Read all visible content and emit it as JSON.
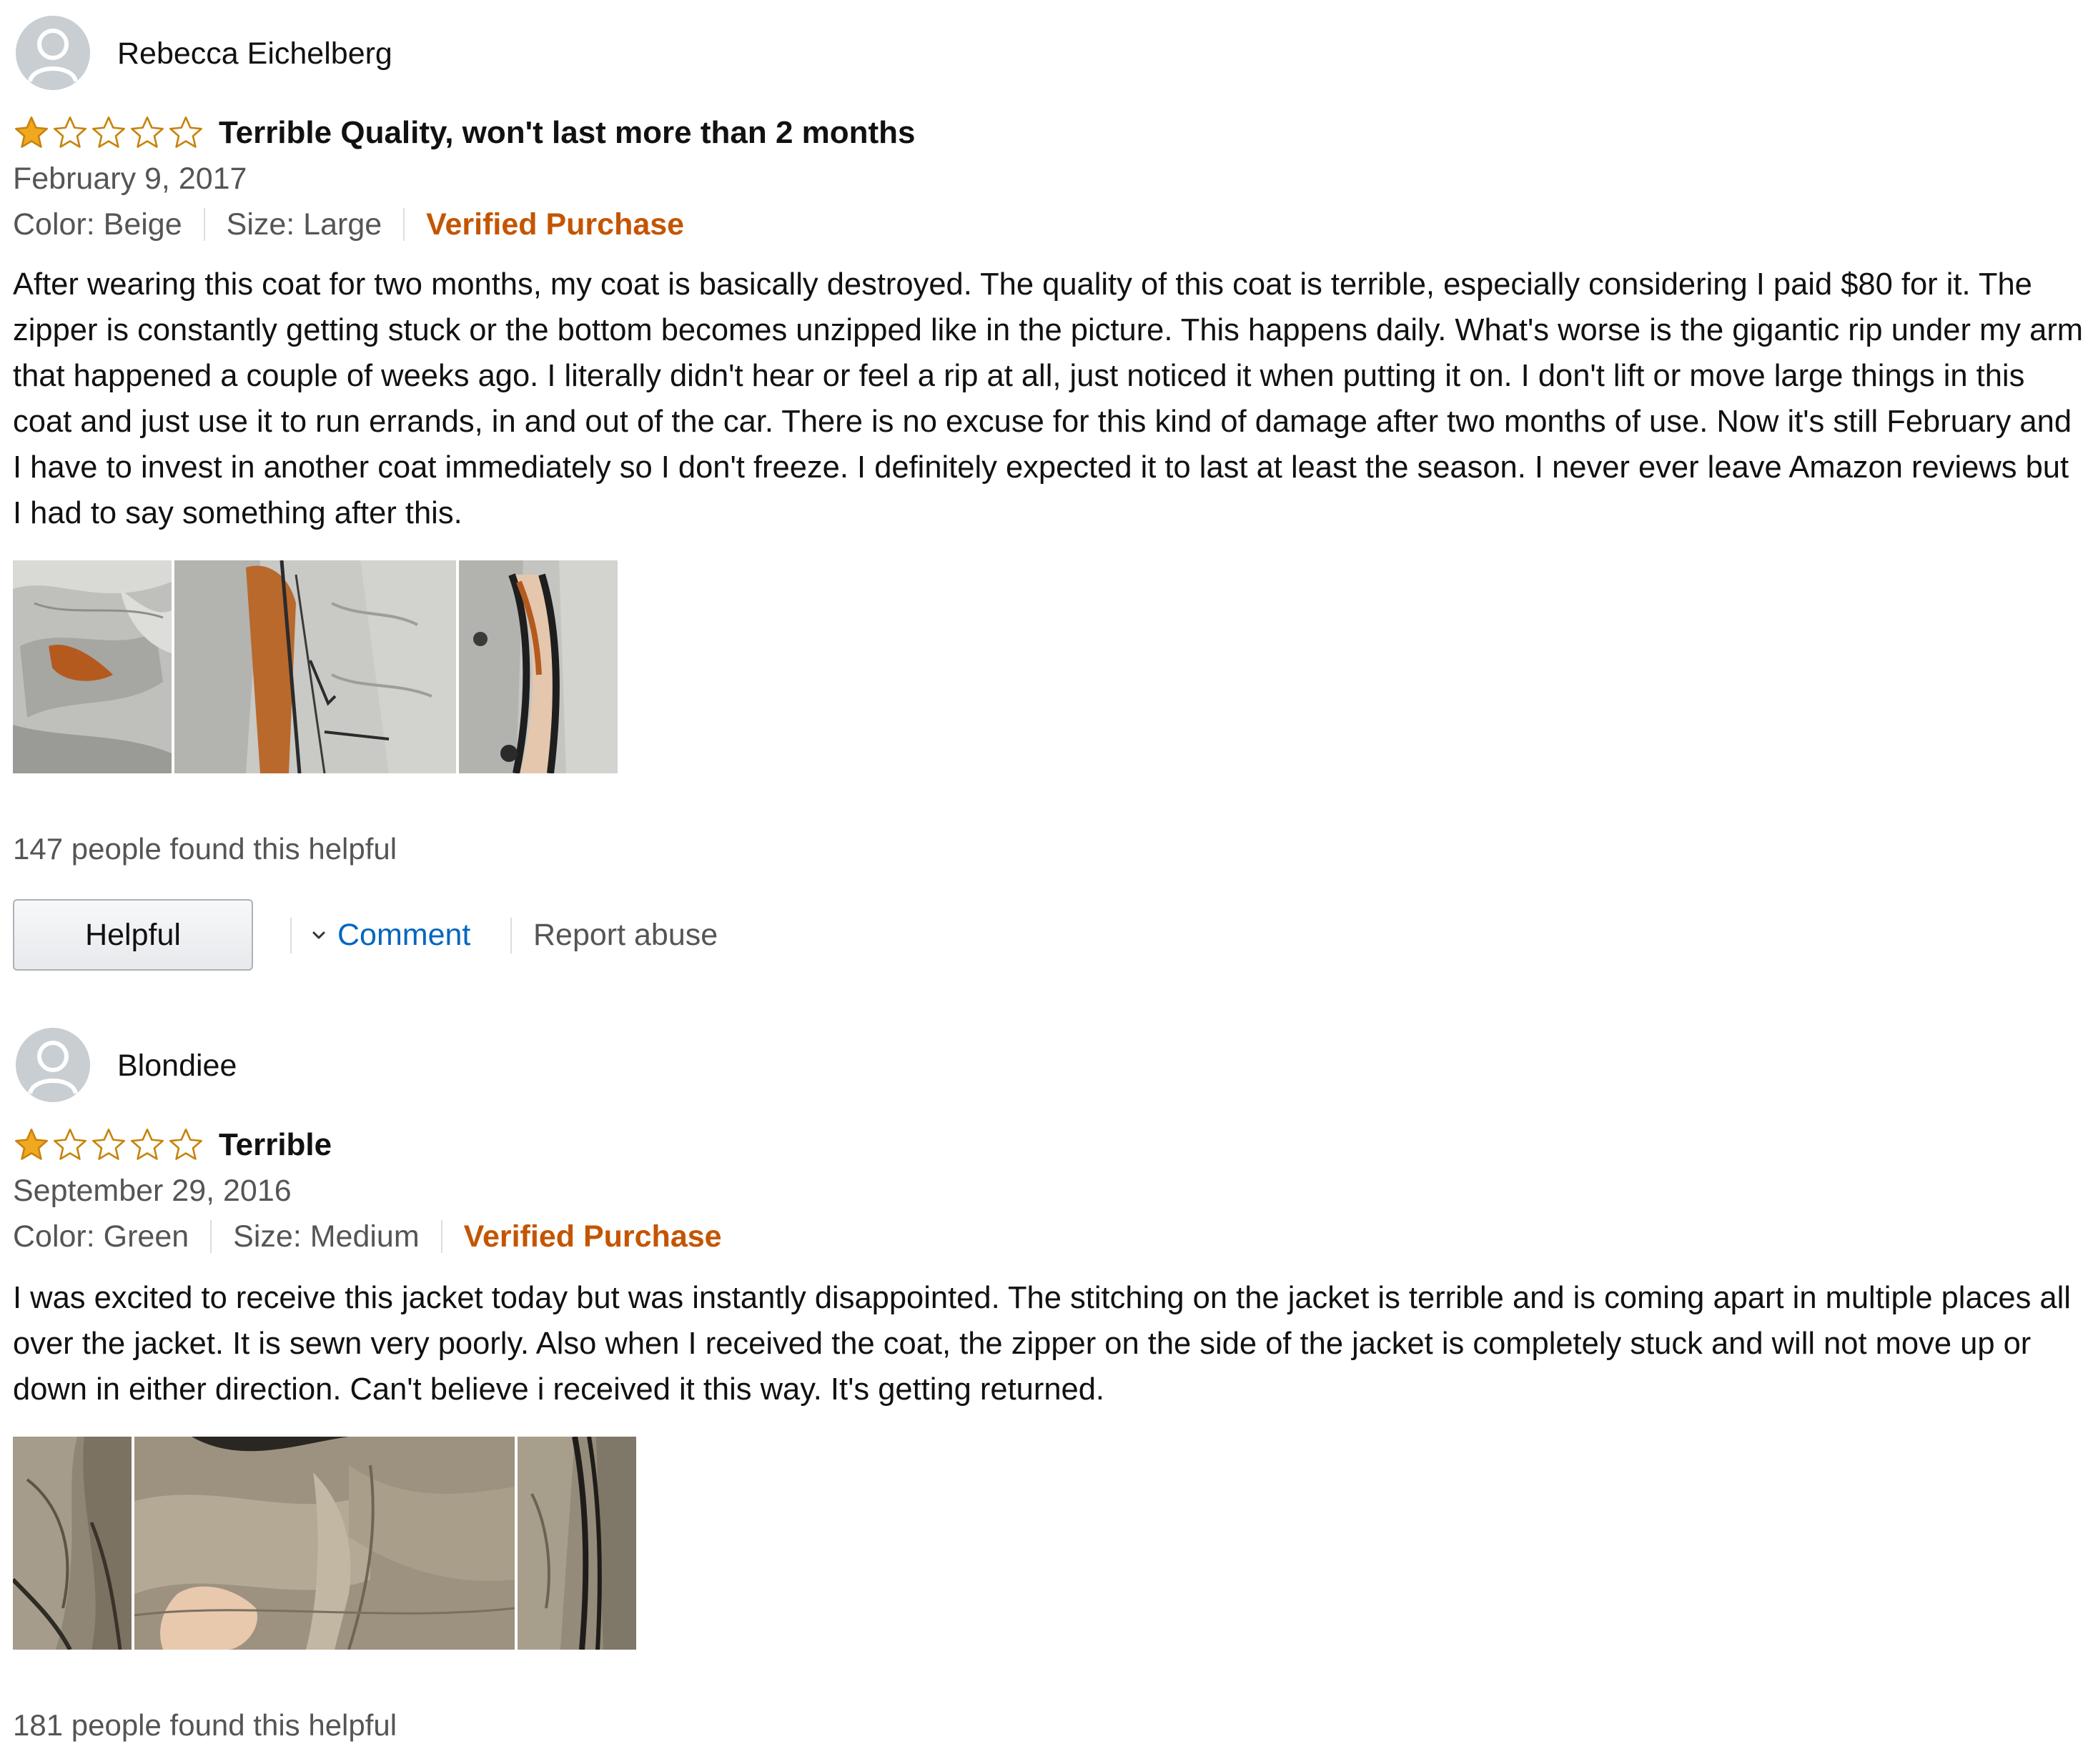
{
  "reviews": [
    {
      "reviewer": "Rebecca Eichelberg",
      "rating": 1,
      "rating_max": 5,
      "title": "Terrible Quality, won't last more than 2 months",
      "date": "February 9, 2017",
      "color": "Color: Beige",
      "size": "Size: Large",
      "verified": "Verified Purchase",
      "body": "After wearing this coat for two months, my coat is basically destroyed. The quality of this coat is terrible, especially considering I paid $80 for it. The zipper is constantly getting stuck or the bottom becomes unzipped like in the picture. This happens daily. What's worse is the gigantic rip under my arm that happened a couple of weeks ago. I literally didn't hear or feel a rip at all, just noticed it when putting it on. I don't lift or move large things in this coat and just use it to run errands, in and out of the car. There is no excuse for this kind of damage after two months of use. Now it's still February and I have to invest in another coat immediately so I don't freeze. I definitely expected it to last at least the season. I never ever leave Amazon reviews but I had to say something after this.",
      "helpful_count": "147 people found this helpful",
      "helpful_label": "Helpful",
      "comment_label": "Comment",
      "report_label": "Report abuse"
    },
    {
      "reviewer": "Blondiee",
      "rating": 1,
      "rating_max": 5,
      "title": "Terrible",
      "date": "September 29, 2016",
      "color": "Color: Green",
      "size": "Size: Medium",
      "verified": "Verified Purchase",
      "body": "I was excited to receive this jacket today but was instantly disappointed. The stitching on the jacket is terrible and is coming apart in multiple places all over the jacket. It is sewn very poorly. Also when I received the coat, the zipper on the side of the jacket is completely stuck and will not move up or down in either direction. Can't believe i received it this way. It's getting returned.",
      "helpful_count": "181 people found this helpful"
    }
  ],
  "icons": {
    "avatar": "default-user-icon",
    "star_filled": "star-filled-icon",
    "star_empty": "star-empty-icon",
    "chevron": "chevron-down-icon"
  },
  "colors": {
    "star": "#f0a820",
    "verified": "#c45500",
    "link": "#0066c0",
    "muted_text": "#555555"
  }
}
